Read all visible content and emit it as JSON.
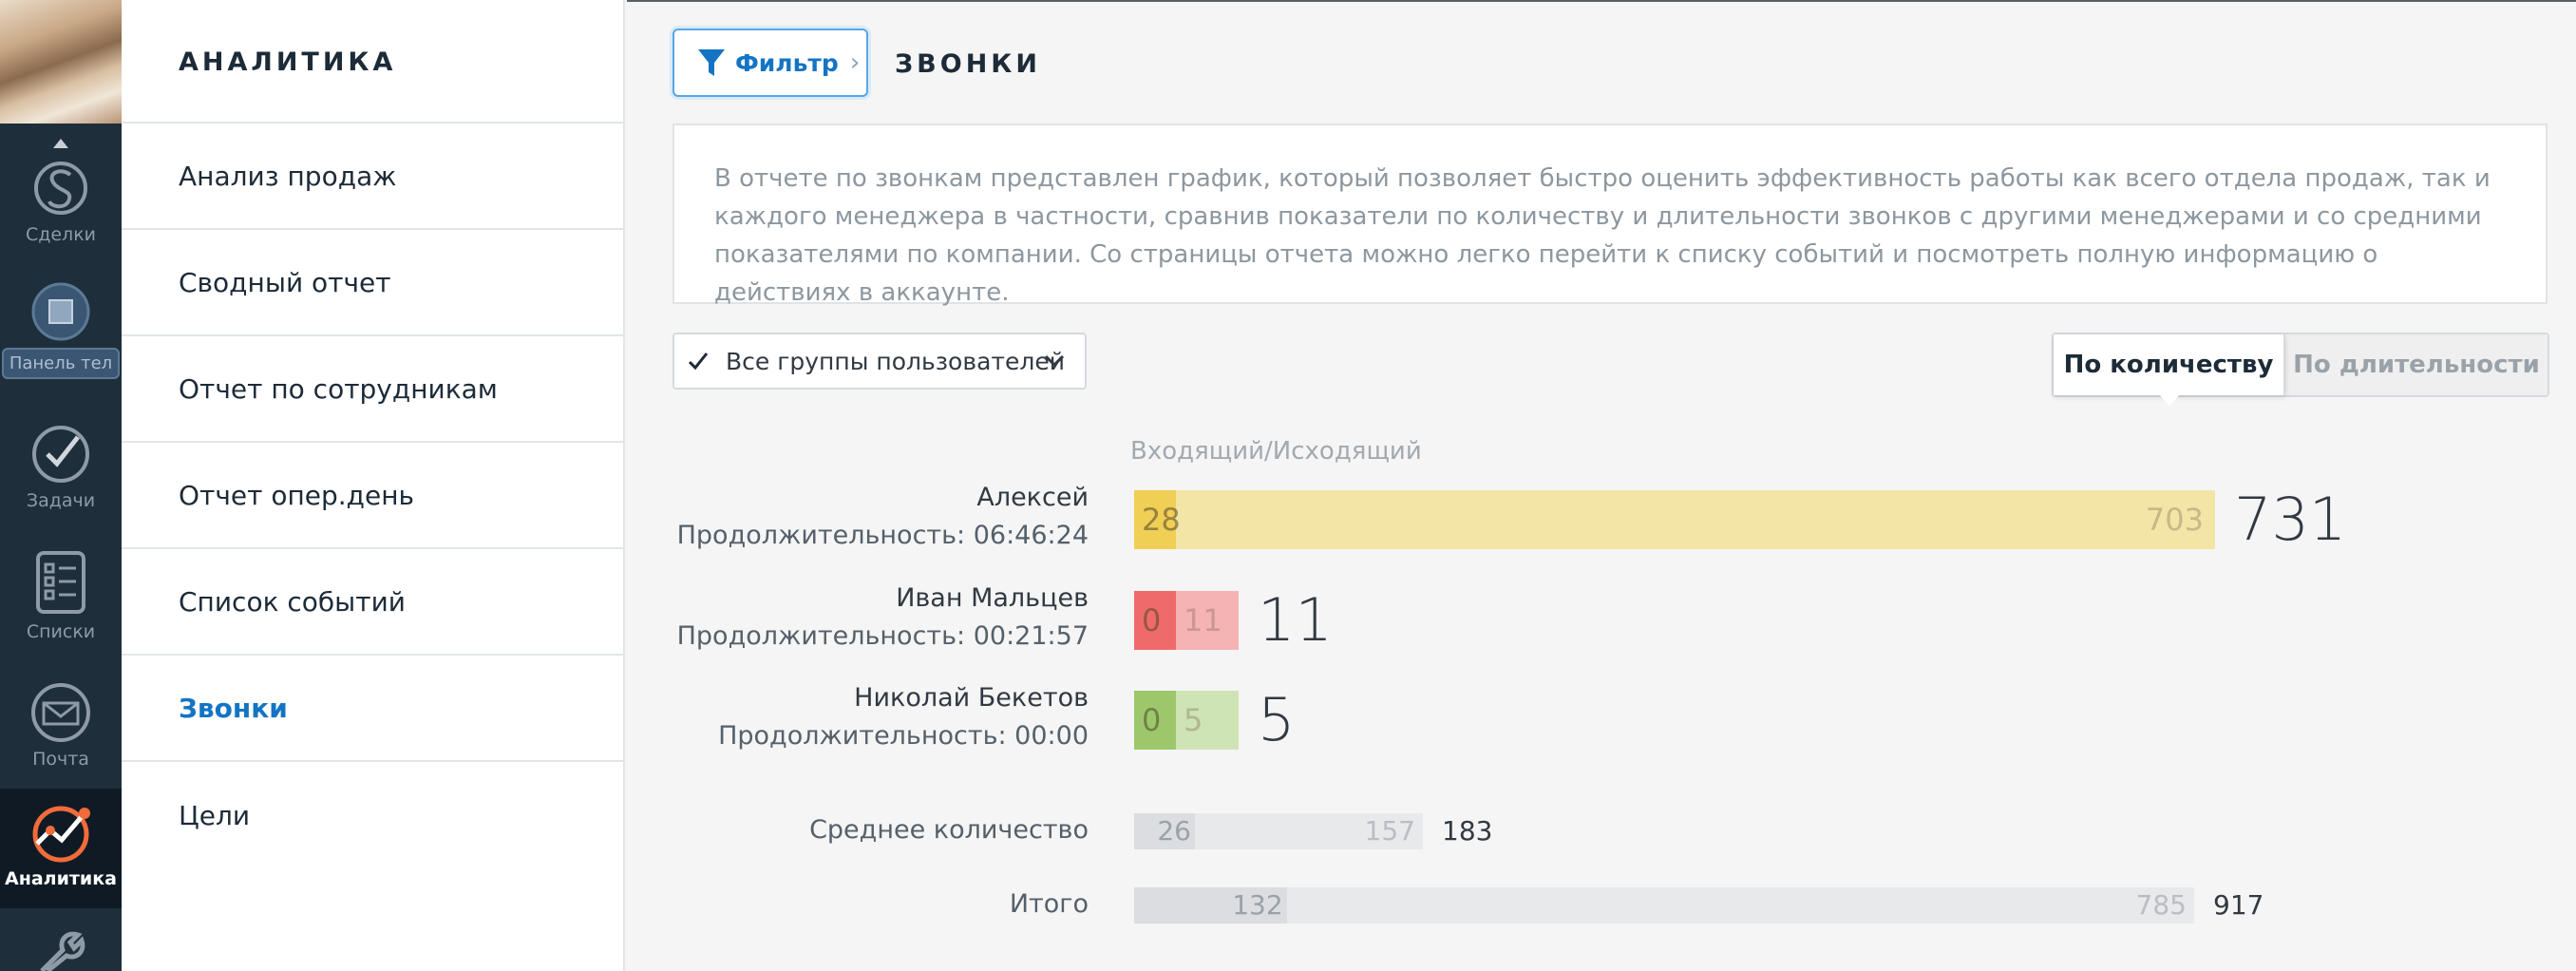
{
  "rail": {
    "items": [
      {
        "label": "Сделки",
        "icon": "deals-icon"
      },
      {
        "label": "Панель тел",
        "icon": "phone-panel-icon"
      },
      {
        "label": "Задачи",
        "icon": "tasks-icon"
      },
      {
        "label": "Списки",
        "icon": "lists-icon"
      },
      {
        "label": "Почта",
        "icon": "mail-icon"
      },
      {
        "label": "Аналитика",
        "icon": "analytics-icon"
      }
    ]
  },
  "menu": {
    "title": "АНАЛИТИКА",
    "items": [
      {
        "label": "Анализ продаж"
      },
      {
        "label": "Сводный отчет"
      },
      {
        "label": "Отчет по сотрудникам"
      },
      {
        "label": "Отчет опер.день"
      },
      {
        "label": "Список событий"
      },
      {
        "label": "Звонки",
        "active": true
      },
      {
        "label": "Цели"
      }
    ]
  },
  "header": {
    "filter_label": "Фильтр",
    "page_title": "ЗВОНКИ"
  },
  "description": "В отчете по звонкам представлен график, который позволяет быстро оценить эффективность работы как всего отдела продаж, так и каждого менеджера в частности, сравнив показатели по количеству и длительности звонков с другими менеджерами и со средними показателями по компании. Со страницы отчета можно легко перейти к списку событий и посмотреть полную информацию о действиях в аккаунте.",
  "controls": {
    "group_select": "Все группы пользователей",
    "group_checked": true,
    "toggle_count": "По количеству",
    "toggle_duration": "По длительности",
    "active_toggle": "count"
  },
  "chart_data": {
    "type": "bar",
    "legend": "Входящий/Исходящий",
    "rows": [
      {
        "name": "Алексей",
        "duration": "Продолжительность: 06:46:24",
        "incoming": 28,
        "outgoing": 703,
        "total": 731,
        "color_in": "#f0cf55",
        "color_out": "#f3e5a6"
      },
      {
        "name": "Иван Мальцев",
        "duration": "Продолжительность: 00:21:57",
        "incoming": 0,
        "outgoing": 11,
        "total": 11,
        "color_in": "#ef6b6b",
        "color_out": "#f5b3b3"
      },
      {
        "name": "Николай Бекетов",
        "duration": "Продолжительность: 00:00",
        "incoming": 0,
        "outgoing": 5,
        "total": 5,
        "color_in": "#9cc86b",
        "color_out": "#cfe4b4"
      }
    ],
    "summary": [
      {
        "name": "Среднее количество",
        "incoming": 26,
        "outgoing": 157,
        "total": 183
      },
      {
        "name": "Итого",
        "incoming": 132,
        "outgoing": 785,
        "total": 917
      }
    ]
  }
}
